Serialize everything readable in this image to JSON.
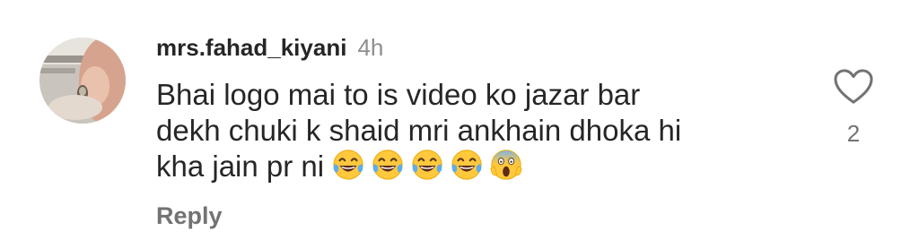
{
  "comment": {
    "username": "mrs.fahad_kiyani",
    "timestamp": "4h",
    "text_lines": [
      "Bhai logo mai to is video ko jazar bar",
      "dekh chuki k shaid mri ankhain dhoka hi",
      "kha jain pr ni"
    ],
    "emojis": [
      "face-with-tears-of-joy-icon",
      "face-with-tears-of-joy-icon",
      "face-with-tears-of-joy-icon",
      "face-with-tears-of-joy-icon",
      "face-screaming-in-fear-icon"
    ],
    "reply_label": "Reply",
    "like_count": "2"
  },
  "colors": {
    "text_primary": "#262626",
    "text_secondary": "#8e8e8e",
    "reply": "#737373",
    "emoji_yellow": "#FFC83D",
    "tear_blue": "#5DADEC"
  }
}
